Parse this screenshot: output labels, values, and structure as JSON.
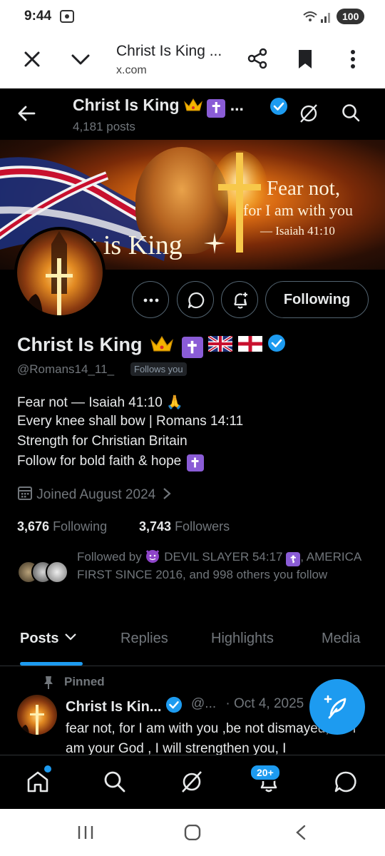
{
  "status_bar": {
    "time": "9:44",
    "battery": "100"
  },
  "custom_tab": {
    "title": "Christ Is King ...",
    "domain": "x.com"
  },
  "header": {
    "name": "Christ Is King",
    "name_trail": "...",
    "post_count": "4,181 posts"
  },
  "banner": {
    "quote_line1": "Fear not,",
    "quote_line2": "for I am with you",
    "quote_line3": "— Isaiah 41:10",
    "overlay_text": "st is King"
  },
  "actions": {
    "following_label": "Following"
  },
  "profile": {
    "name": "Christ Is King",
    "handle": "@Romans14_11_",
    "follows_you": "Follows you",
    "bio": [
      "Fear not — Isaiah 41:10 🙏",
      "Every knee shall bow | Romans 14:11",
      "Strength for Christian Britain",
      "Follow for bold faith & hope"
    ],
    "joined": "Joined August 2024",
    "following_count": "3,676",
    "following_label": "Following",
    "followers_count": "3,743",
    "followers_label": "Followers",
    "followed_by_prefix": "Followed by",
    "followed_by_first": "DEVIL SLAYER 54:17",
    "followed_by_rest": "AMERICA FIRST SINCE 2016, and 998 others you follow"
  },
  "tabs": [
    {
      "label": "Posts",
      "active": true
    },
    {
      "label": "Replies",
      "active": false
    },
    {
      "label": "Highlights",
      "active": false
    },
    {
      "label": "Media",
      "active": false
    }
  ],
  "pinned_tweet": {
    "pinned_label": "Pinned",
    "name": "Christ Is Kin...",
    "handle": "@...",
    "date": "· Oct 4, 2025",
    "text": "fear not, for I am with you ,be not dismayed, for I am your God , I will strengthen you, I"
  },
  "bottom_nav": {
    "notification_badge": "20+"
  },
  "colors": {
    "accent": "#1d9bf0",
    "background": "#000000",
    "muted": "#71767b",
    "text": "#e7e9ea"
  }
}
